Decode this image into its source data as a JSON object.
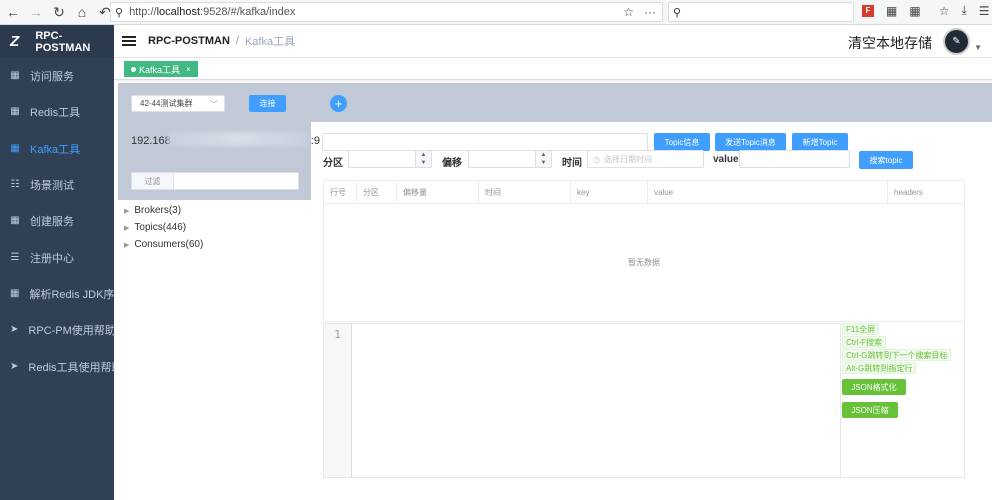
{
  "browser": {
    "url_prefix": "http://",
    "url_host": "localhost",
    "url_path": ":9528/#/kafka/index",
    "page_actions": "···"
  },
  "sidebar": {
    "brand": "RPC-POSTMAN",
    "items": [
      {
        "label": "访问服务",
        "icon": "grid-icon",
        "active": false
      },
      {
        "label": "Redis工具",
        "icon": "grid-icon",
        "active": false
      },
      {
        "label": "Kafka工具",
        "icon": "grid-icon",
        "active": true
      },
      {
        "label": "场景测试",
        "icon": "list-icon",
        "active": false
      },
      {
        "label": "创建服务",
        "icon": "grid-icon",
        "active": false
      },
      {
        "label": "注册中心",
        "icon": "list-icon",
        "active": false
      },
      {
        "label": "解析Redis JDK序列化",
        "icon": "grid-icon",
        "active": false
      },
      {
        "label": "RPC-PM使用帮助",
        "icon": "send-icon",
        "active": false
      },
      {
        "label": "Redis工具使用帮助",
        "icon": "send-icon",
        "active": false
      }
    ]
  },
  "header": {
    "breadcrumb_root": "RPC-POSTMAN",
    "breadcrumb_separator": "/",
    "breadcrumb_current": "Kafka工具",
    "clear_storage": "清空本地存储"
  },
  "tags": [
    {
      "label": "Kafka工具",
      "close": "×"
    }
  ],
  "left_panel": {
    "cluster_select": "42-44测试集群",
    "connect_button": "连接",
    "add_button": "+",
    "ip_visible": "192.168",
    "ip_port_suffix": ":9",
    "filter_label": "过滤",
    "filter_value": ""
  },
  "tree": [
    {
      "label": "Brokers(3)"
    },
    {
      "label": "Topics(446)"
    },
    {
      "label": "Consumers(60)"
    }
  ],
  "topic_form": {
    "topic_value": "",
    "topic_info_button": "Topic信息",
    "send_topic_button": "发送Topic消息",
    "new_topic_button": "新增Topic",
    "partition_label": "分区",
    "offset_label": "偏移",
    "time_label": "时间",
    "date_placeholder": "选择日期时间",
    "value_label": "value",
    "search_button": "搜索topic"
  },
  "table": {
    "columns": [
      "行号",
      "分区",
      "偏移量",
      "时间",
      "key",
      "value",
      "headers"
    ],
    "empty_text": "暂无数据"
  },
  "editor": {
    "line_number": "1",
    "hints": [
      "F11全屏",
      "Ctrl-F搜索",
      "Ctrl-G跳转到下一个搜索目标",
      "Alt-G跳转到指定行"
    ],
    "json_format_button": "JSON格式化",
    "json_compress_button": "JSON压缩"
  },
  "colors": {
    "sidebar_bg": "#304156",
    "active_menu": "#409eff",
    "primary": "#409eff",
    "success": "#67c23a",
    "tag_green": "#42b983",
    "panel_bg": "#c1c9d7"
  }
}
